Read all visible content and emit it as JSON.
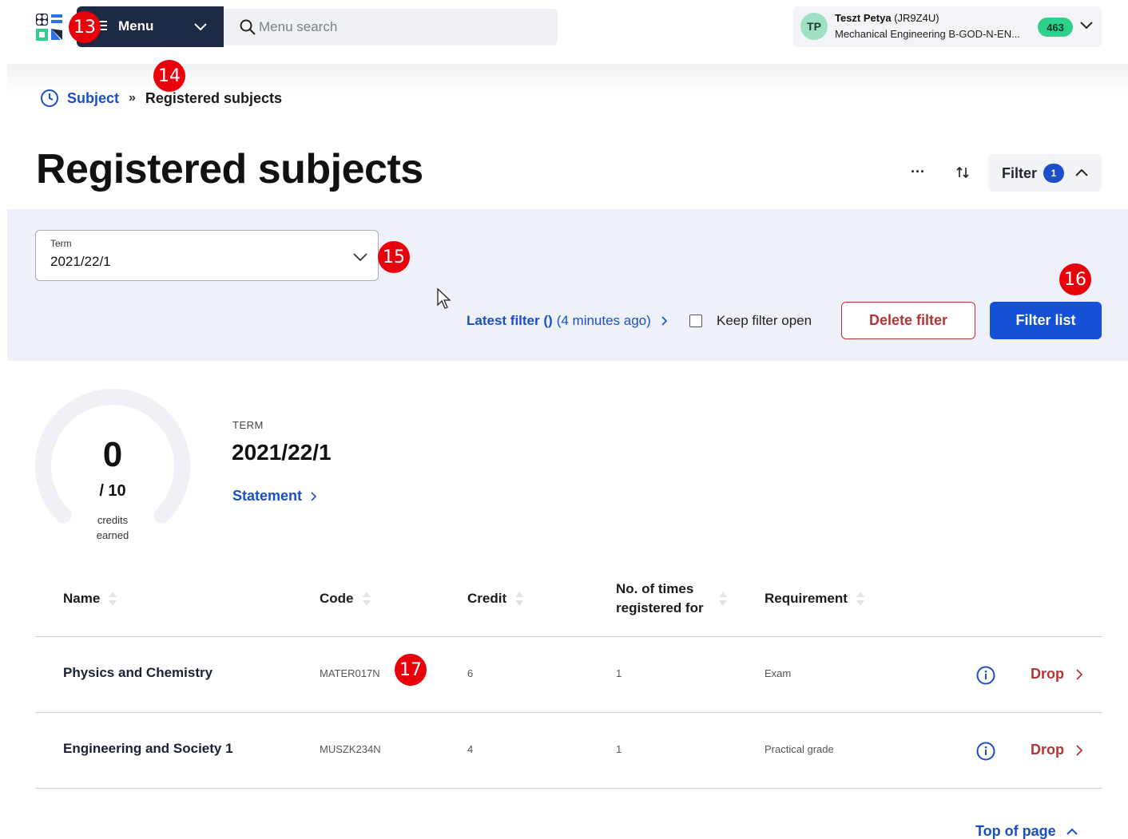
{
  "header": {
    "menu_label": "Menu",
    "search_placeholder": "Menu search",
    "user": {
      "initials": "TP",
      "name": "Teszt Petya",
      "code": "(JR9Z4U)",
      "program": "Mechanical Engineering B-GOD-N-EN...",
      "badge": "463"
    }
  },
  "breadcrumb": {
    "parent": "Subject",
    "separator": "»",
    "current": "Registered subjects"
  },
  "page_title": "Registered subjects",
  "toolbar": {
    "more": "···",
    "filter_label": "Filter",
    "filter_count": "1"
  },
  "filter_panel": {
    "term_label": "Term",
    "term_value": "2021/22/1",
    "latest_filter_label": "Latest filter ()",
    "latest_filter_time": "(4 minutes ago)",
    "keep_open_label": "Keep filter open",
    "delete_label": "Delete filter",
    "filter_list_label": "Filter list"
  },
  "summary": {
    "credits_earned": "0",
    "credits_total": "/ 10",
    "credits_label": "credits earned",
    "credits_fraction": 0,
    "term_caption": "TERM",
    "term_value": "2021/22/1",
    "statement_label": "Statement"
  },
  "table": {
    "headers": {
      "name": "Name",
      "code": "Code",
      "credit": "Credit",
      "times_line1": "No. of times",
      "times_line2": "registered for",
      "requirement": "Requirement"
    },
    "rows": [
      {
        "name": "Physics and Chemistry",
        "code": "MATER017N",
        "credit": "6",
        "times": "1",
        "requirement": "Exam",
        "action": "Drop"
      },
      {
        "name": "Engineering and Society 1",
        "code": "MUSZK234N",
        "credit": "4",
        "times": "1",
        "requirement": "Practical grade",
        "action": "Drop"
      }
    ]
  },
  "footer": {
    "top_of_page": "Top of page"
  },
  "markers": [
    "13",
    "14",
    "15",
    "16",
    "17"
  ],
  "colors": {
    "accent": "#1451d6",
    "danger": "#b53434",
    "marker": "#e8000b",
    "menu_bg": "#1e2a43",
    "badge_green": "#2ed08a"
  }
}
